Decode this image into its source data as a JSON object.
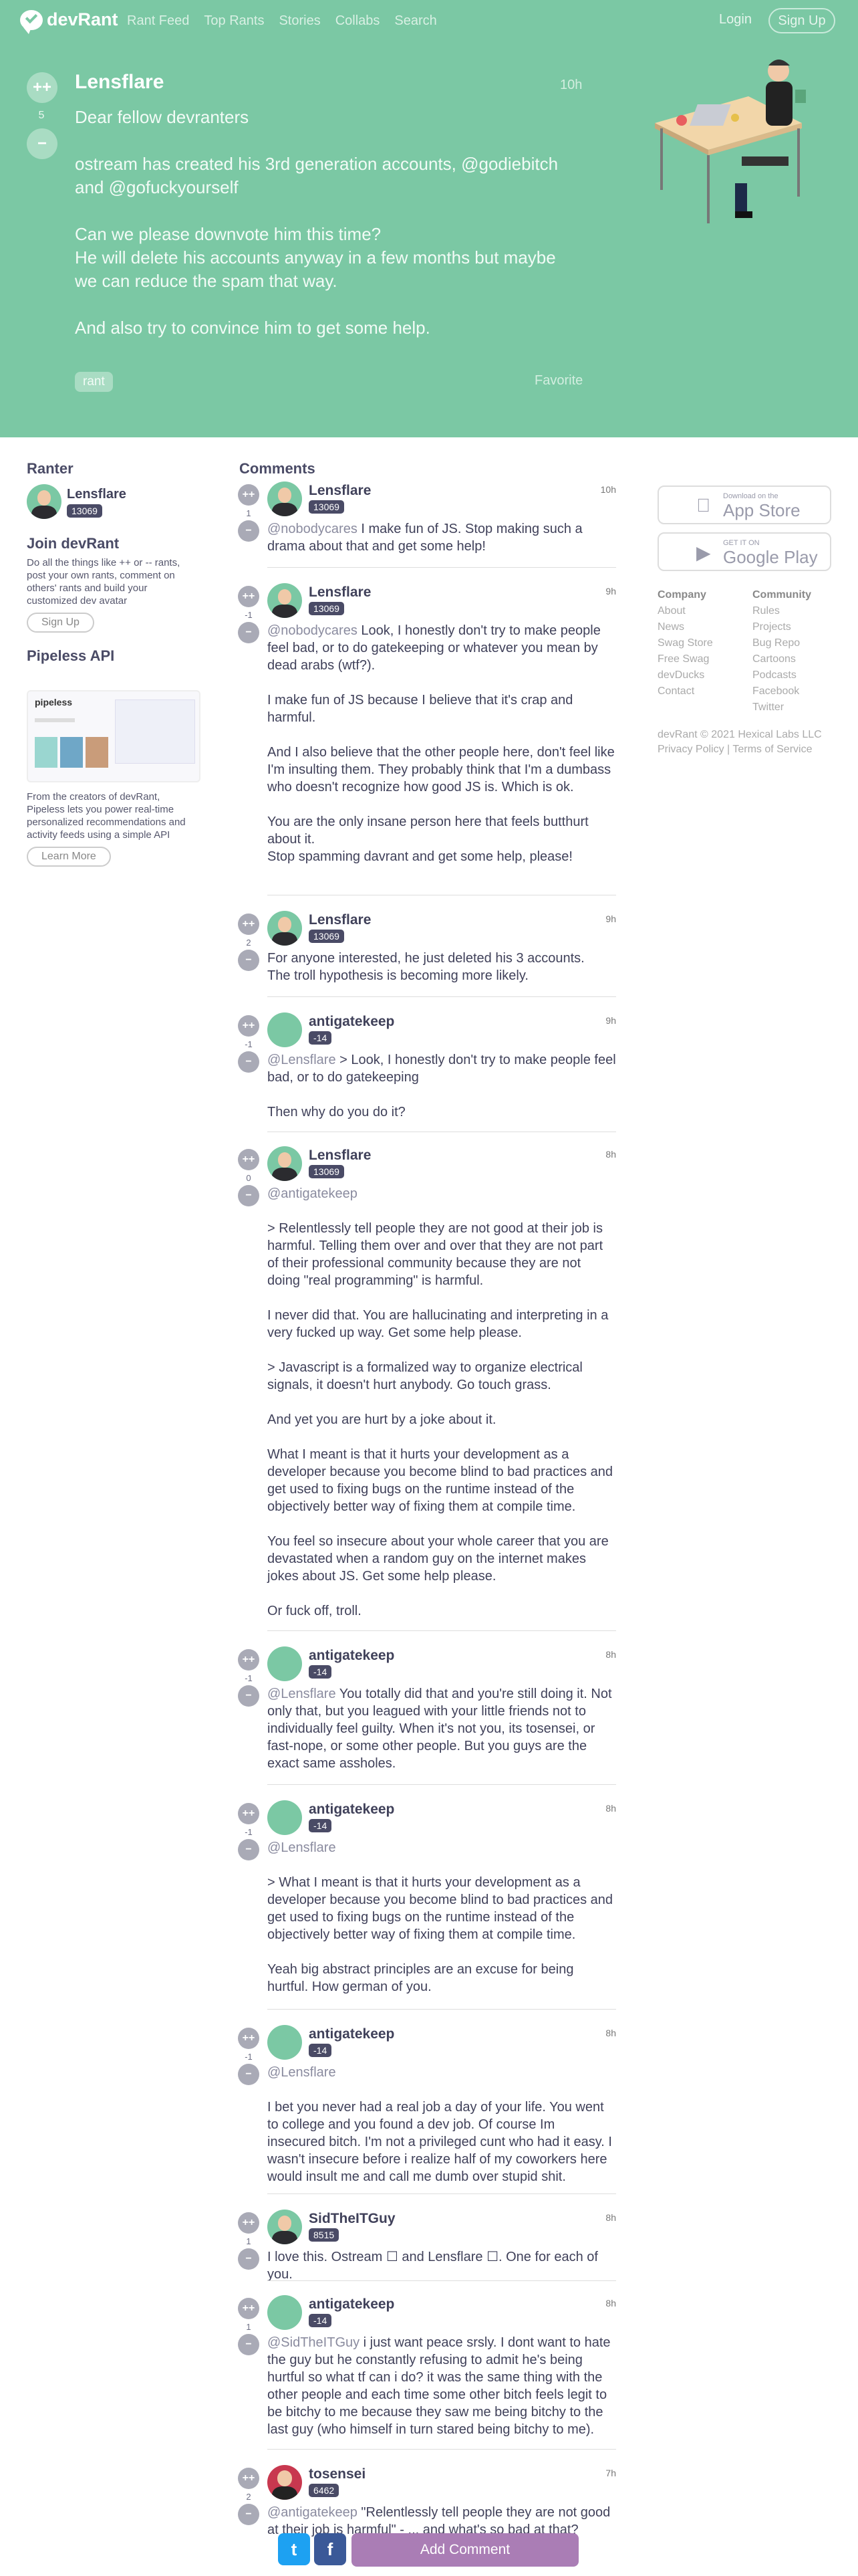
{
  "nav": {
    "logo": "devRant",
    "links": [
      "Rant Feed",
      "Top Rants",
      "Stories",
      "Collabs",
      "Search"
    ],
    "login": "Login",
    "signup": "Sign Up"
  },
  "rant": {
    "upvote": "++",
    "downvote": "−",
    "score": "5",
    "user": "Lensflare",
    "time": "10h",
    "body": "Dear fellow devranters\n\nostream has created his 3rd generation accounts, @godiebitch\nand @gofuckyourself\n\nCan we please downvote him this time?\nHe will delete his accounts anyway in a few months but maybe\nwe can reduce the spam that way.\n\nAnd also try to convince him to get some help.",
    "tag": "rant",
    "favorite": "Favorite"
  },
  "sidebar": {
    "ranter_heading": "Ranter",
    "ranter_name": "Lensflare",
    "ranter_score": "13069",
    "join_heading": "Join devRant",
    "join_text": "Do all the things like ++ or -- rants, post your own rants, comment on others' rants and build your customized dev avatar",
    "join_button": "Sign Up",
    "pipeless_heading": "Pipeless API",
    "pipeless_logo": "pipeless",
    "pipeless_text": "From the creators of devRant, Pipeless lets you power real-time personalized recommendations and activity feeds using a simple API",
    "pipeless_button": "Learn More"
  },
  "comments_heading": "Comments",
  "comments": [
    {
      "user": "Lensflare",
      "score": "13069",
      "votes": "1",
      "time": "10h",
      "mention": "@nobodycares",
      "text": " I make fun of JS. Stop making such a drama about that and get some help!",
      "avatar": "dark"
    },
    {
      "user": "Lensflare",
      "score": "13069",
      "votes": "-1",
      "time": "9h",
      "mention": "@nobodycares",
      "text": " Look, I honestly don't try to make people feel bad, or to do gatekeeping or whatever you mean by dead arabs (wtf?).\n\nI make fun of JS because I believe that it's crap and harmful.\n\nAnd I also believe that the other people here, don't feel like I'm insulting them. They probably think that I'm a dumbass who doesn't recognize how good JS is. Which is ok.\n\nYou are the only insane person here that feels butthurt about it.\nStop spamming davrant and get some help, please!",
      "avatar": "dark"
    },
    {
      "user": "Lensflare",
      "score": "13069",
      "votes": "2",
      "time": "9h",
      "mention": "",
      "text": "For anyone interested, he just deleted his 3 accounts.\nThe troll hypothesis is becoming more likely.",
      "avatar": "dark"
    },
    {
      "user": "antigatekeep",
      "score": "-14",
      "votes": "-1",
      "time": "9h",
      "mention": "@Lensflare",
      "text": " > Look, I honestly don't try to make people feel bad, or to do gatekeeping\n\nThen why do you do it?",
      "avatar": "green"
    },
    {
      "user": "Lensflare",
      "score": "13069",
      "votes": "0",
      "time": "8h",
      "mention": "@antigatekeep",
      "text": "\n\n> Relentlessly tell people they are not good at their job is harmful. Telling them over and over that they are not part of their professional community because they are not doing \"real programming\" is harmful.\n\nI never did that. You are hallucinating and interpreting in a very fucked up way. Get some help please.\n\n> Javascript is a formalized way to organize electrical signals, it doesn't hurt anybody. Go touch grass.\n\nAnd yet you are hurt by a joke about it.\n\nWhat I meant is that it hurts your development as a developer because you become blind to bad practices and get used to fixing bugs on the runtime instead of the objectively better way of fixing them at compile time.\n\nYou feel so insecure about your whole career that you are devastated when a random guy on the internet makes jokes about JS. Get some help please.\n\nOr fuck off, troll.",
      "avatar": "dark"
    },
    {
      "user": "antigatekeep",
      "score": "-14",
      "votes": "-1",
      "time": "8h",
      "mention": "@Lensflare",
      "text": " You totally did that and you're still doing it. Not only that, but you leagued with your little friends not to individually feel guilty. When it's not you, its tosensei, or fast-nope, or some other people. But you guys are the exact same assholes.",
      "avatar": "green"
    },
    {
      "user": "antigatekeep",
      "score": "-14",
      "votes": "-1",
      "time": "8h",
      "mention": "@Lensflare",
      "text": "\n\n> What I meant is that it hurts your development as a developer because you become blind to bad practices and get used to fixing bugs on the runtime instead of the objectively better way of fixing them at compile time.\n\nYeah big abstract principles are an excuse for being hurtful. How german of you.",
      "avatar": "green"
    },
    {
      "user": "antigatekeep",
      "score": "-14",
      "votes": "-1",
      "time": "8h",
      "mention": "@Lensflare",
      "text": "\n\nI bet you never had a real job a day of your life. You went to college and you found a dev job. Of course Im insecured bitch. I'm not a privileged cunt who had it easy. I wasn't insecure before i realize half of my coworkers here would insult me and call me dumb over stupid shit.",
      "avatar": "green"
    },
    {
      "user": "SidTheITGuy",
      "score": "8515",
      "votes": "1",
      "time": "8h",
      "mention": "",
      "text": "I love this. Ostream ☐ and Lensflare ☐. One for each of you.",
      "avatar": "dark"
    },
    {
      "user": "antigatekeep",
      "score": "-14",
      "votes": "1",
      "time": "8h",
      "mention": "@SidTheITGuy",
      "text": " i just want peace srsly. I dont want to hate the guy but he constantly refusing to admit he's being hurtful so what tf can i do? it was the same thing with the other people and each time some other bitch feels legit to be bitchy to me because they saw me being bitchy to the last guy (who himself in turn stared being bitchy to me).",
      "avatar": "green"
    },
    {
      "user": "tosensei",
      "score": "6462",
      "votes": "2",
      "time": "7h",
      "mention": "@antigatekeep",
      "text": " \"Relentlessly tell people they are not good at their job is harmful\" - ... and what's so bad at that?",
      "avatar": "tosen"
    }
  ],
  "stores": {
    "app_small": "Download on the",
    "app_big": "App Store",
    "play_small": "GET IT ON",
    "play_big": "Google Play"
  },
  "footer": {
    "company_heading": "Company",
    "company": [
      "About",
      "News",
      "Swag Store",
      "Free Swag",
      "devDucks",
      "Contact"
    ],
    "community_heading": "Community",
    "community": [
      "Rules",
      "Projects",
      "Bug Repo",
      "Cartoons",
      "Podcasts",
      "Facebook",
      "Twitter"
    ],
    "copyright": "devRant © 2021 Hexical Labs LLC",
    "privacy": "Privacy Policy",
    "terms": "Terms of Service"
  },
  "bottom": {
    "twitter": "t",
    "facebook": "f",
    "add_comment": "Add Comment"
  },
  "colors": {
    "hero": "#7bc8a4",
    "add_comment": "#aa7db5",
    "twitter": "#1da1f2",
    "facebook": "#3b5998"
  }
}
